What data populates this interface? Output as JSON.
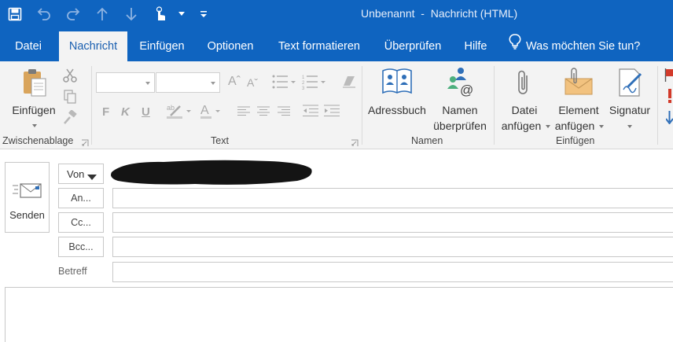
{
  "window": {
    "title": "Unbenannt  -  Nachricht (HTML)"
  },
  "quick_access": [
    {
      "name": "save-icon"
    },
    {
      "name": "undo-icon"
    },
    {
      "name": "redo-icon"
    },
    {
      "name": "arrow-up-icon"
    },
    {
      "name": "arrow-down-icon"
    },
    {
      "name": "touch-mode-icon"
    },
    {
      "name": "customize-qat-icon"
    }
  ],
  "tabs": [
    {
      "label": "Datei",
      "active": false
    },
    {
      "label": "Nachricht",
      "active": true
    },
    {
      "label": "Einfügen",
      "active": false
    },
    {
      "label": "Optionen",
      "active": false
    },
    {
      "label": "Text formatieren",
      "active": false
    },
    {
      "label": "Überprüfen",
      "active": false
    },
    {
      "label": "Hilfe",
      "active": false
    }
  ],
  "tell_me": {
    "label": "Was möchten Sie tun?",
    "icon": "lightbulb-icon"
  },
  "ribbon": {
    "clipboard": {
      "group_label": "Zwischenablage",
      "paste_label": "Einfügen"
    },
    "text": {
      "group_label": "Text",
      "bold": "F",
      "italic": "K",
      "underline": "U"
    },
    "names": {
      "group_label": "Namen",
      "address_book_label": "Adressbuch",
      "check_names_line1": "Namen",
      "check_names_line2": "überprüfen"
    },
    "insert": {
      "group_label": "Einfügen",
      "attach_file_line1": "Datei",
      "attach_file_line2": "anfügen",
      "attach_item_line1": "Element",
      "attach_item_line2": "anfügen",
      "signature_label": "Signatur"
    }
  },
  "compose": {
    "send_label": "Senden",
    "from_label": "Von",
    "to_label": "An...",
    "cc_label": "Cc...",
    "bcc_label": "Bcc...",
    "subject_label": "Betreff",
    "to_value": "",
    "cc_value": "",
    "bcc_value": "",
    "subject_value": ""
  },
  "colors": {
    "titlebar": "#0f64c0",
    "ribbon_bg": "#f3f3f3",
    "active_tab_text": "#1a5fb0"
  }
}
